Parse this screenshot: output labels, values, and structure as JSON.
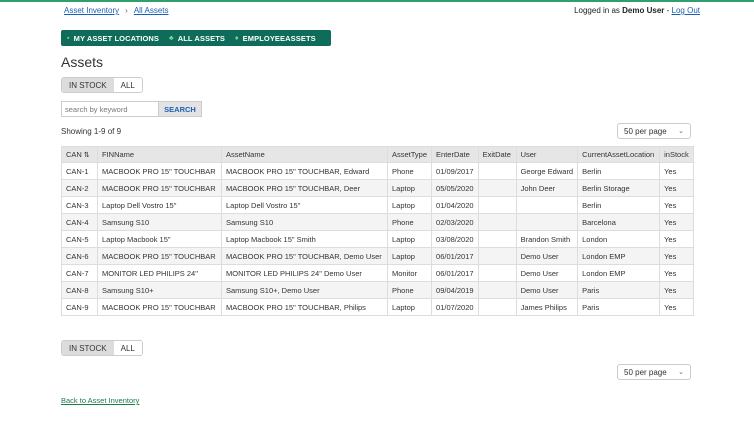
{
  "breadcrumb": {
    "home": "Asset Inventory",
    "sep": "›",
    "current": "All Assets"
  },
  "login": {
    "prefix": "Logged in as",
    "user": "Demo User",
    "dash": "-",
    "logout": "Log Out"
  },
  "nav": [
    {
      "icon": "▪",
      "icon_name": "location-icon",
      "label": "MY ASSET LOCATIONS"
    },
    {
      "icon": "♣",
      "icon_name": "assets-icon",
      "label": "ALL ASSETS"
    },
    {
      "icon": "♦",
      "icon_name": "employee-icon",
      "label": "EMPLOYEEASSETS"
    }
  ],
  "page_title": "Assets",
  "filter": {
    "in_stock": "IN STOCK",
    "all": "ALL"
  },
  "search": {
    "placeholder": "search by keyword",
    "button": "SEARCH"
  },
  "showing": "Showing 1-9 of 9",
  "per_page": "50 per page",
  "table": {
    "headers": [
      "CAN",
      "FINName",
      "AssetName",
      "AssetType",
      "EnterDate",
      "ExitDate",
      "User",
      "CurrentAssetLocation",
      "inStock"
    ],
    "rows": [
      [
        "CAN-1",
        "MACBOOK PRO 15\" TOUCHBAR",
        "MACBOOK PRO 15\" TOUCHBAR, Edward",
        "Phone",
        "01/09/2017",
        "",
        "George Edward",
        "Berlin",
        "Yes"
      ],
      [
        "CAN-2",
        "MACBOOK PRO 15\" TOUCHBAR",
        "MACBOOK PRO 15\" TOUCHBAR, Deer",
        "Laptop",
        "05/05/2020",
        "",
        "John Deer",
        "Berlin Storage",
        "Yes"
      ],
      [
        "CAN-3",
        "Laptop Dell Vostro 15\"",
        "Laptop Dell Vostro 15\"",
        "Laptop",
        "01/04/2020",
        "",
        "",
        "Berlin",
        "Yes"
      ],
      [
        "CAN-4",
        "Samsung S10",
        "Samsung S10",
        "Phone",
        "02/03/2020",
        "",
        "",
        "Barcelona",
        "Yes"
      ],
      [
        "CAN-5",
        "Laptop Macbook 15\"",
        "Laptop Macbook 15\" Smith",
        "Laptop",
        "03/08/2020",
        "",
        "Brandon Smith",
        "London",
        "Yes"
      ],
      [
        "CAN-6",
        "MACBOOK PRO 15\" TOUCHBAR",
        "MACBOOK PRO 15\" TOUCHBAR, Demo User",
        "Laptop",
        "06/01/2017",
        "",
        "Demo User",
        "London EMP",
        "Yes"
      ],
      [
        "CAN-7",
        "MONITOR LED PHILIPS 24\"",
        "MONITOR LED PHILIPS 24\" Demo User",
        "Monitor",
        "06/01/2017",
        "",
        "Demo User",
        "London EMP",
        "Yes"
      ],
      [
        "CAN-8",
        "Samsung S10+",
        "Samsung S10+, Demo User",
        "Phone",
        "09/04/2019",
        "",
        "Demo User",
        "Paris",
        "Yes"
      ],
      [
        "CAN-9",
        "MACBOOK PRO 15\" TOUCHBAR",
        "MACBOOK PRO 15\" TOUCHBAR, Philips",
        "Laptop",
        "01/07/2020",
        "",
        "James Philips",
        "Paris",
        "Yes"
      ]
    ]
  },
  "back_link": "Back to Asset Inventory",
  "colors": {
    "nav_bg": "#0f6b5a",
    "link": "#1a5fb4",
    "back_link": "#1f7a4f",
    "accent_line": "#2f9f6f"
  }
}
